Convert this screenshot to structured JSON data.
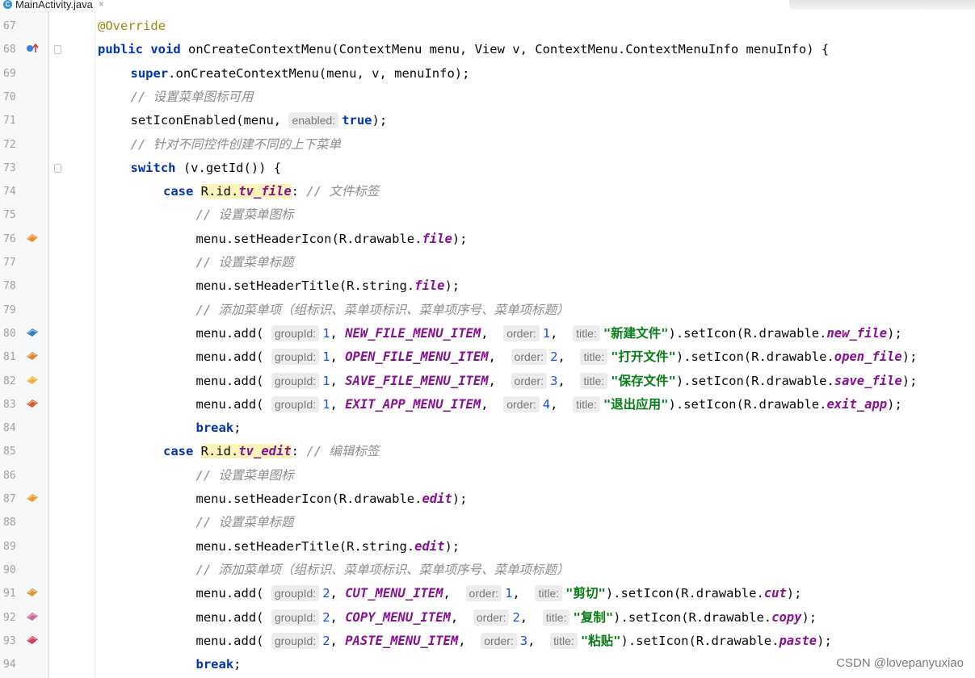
{
  "tab": {
    "icon": "C",
    "name": "MainActivity.java",
    "close": "×"
  },
  "watermark": "CSDN @lovepanyuxiao",
  "colors": {
    "keyword": "#0033b3",
    "string": "#067d17",
    "number": "#1750eb",
    "field": "#871094",
    "comment": "#8c8c8c",
    "annotation": "#9e880d"
  },
  "lines": [
    {
      "num": "67",
      "indent": 0,
      "tokens": [
        {
          "t": "@Override",
          "c": "ann"
        }
      ]
    },
    {
      "num": "68",
      "indent": 0,
      "marker": "override-icon",
      "fold": true,
      "tokens": [
        {
          "t": "public void ",
          "c": "kw"
        },
        {
          "t": "onCreateContextMenu(ContextMenu menu, View v, ContextMenu.ContextMenuInfo menuInfo) {"
        }
      ]
    },
    {
      "num": "69",
      "indent": 1,
      "tokens": [
        {
          "t": "super",
          "c": "kw"
        },
        {
          "t": ".onCreateContextMenu(menu, v, menuInfo);"
        }
      ]
    },
    {
      "num": "70",
      "indent": 1,
      "tokens": [
        {
          "t": "// 设置菜单图标可用",
          "c": "cm"
        }
      ]
    },
    {
      "num": "71",
      "indent": 1,
      "tokens": [
        {
          "t": "setIconEnabled(menu, "
        },
        {
          "t": "enabled:",
          "c": "hint"
        },
        {
          "t": "true",
          "c": "kw"
        },
        {
          "t": ");"
        }
      ]
    },
    {
      "num": "72",
      "indent": 1,
      "tokens": [
        {
          "t": "// 针对不同控件创建不同的上下菜单",
          "c": "cm"
        }
      ]
    },
    {
      "num": "73",
      "indent": 1,
      "fold": true,
      "tokens": [
        {
          "t": "switch ",
          "c": "kw"
        },
        {
          "t": "(v.getId()) {"
        }
      ]
    },
    {
      "num": "74",
      "indent": 2,
      "tokens": [
        {
          "t": "case ",
          "c": "kw"
        },
        {
          "t": "R.id.",
          "c": "hl"
        },
        {
          "t": "tv_file",
          "c": "fld hl"
        },
        {
          "t": ": "
        },
        {
          "t": "// 文件标签",
          "c": "cm"
        }
      ]
    },
    {
      "num": "75",
      "indent": 3,
      "tokens": [
        {
          "t": "// 设置菜单图标",
          "c": "cm"
        }
      ]
    },
    {
      "num": "76",
      "indent": 3,
      "marker": "file-icon",
      "markerColor": "#e8902c",
      "tokens": [
        {
          "t": "menu.setHeaderIcon(R.drawable."
        },
        {
          "t": "file",
          "c": "fld"
        },
        {
          "t": ");"
        }
      ]
    },
    {
      "num": "77",
      "indent": 3,
      "tokens": [
        {
          "t": "// 设置菜单标题",
          "c": "cm"
        }
      ]
    },
    {
      "num": "78",
      "indent": 3,
      "tokens": [
        {
          "t": "menu.setHeaderTitle(R.string."
        },
        {
          "t": "file",
          "c": "fld"
        },
        {
          "t": ");"
        }
      ]
    },
    {
      "num": "79",
      "indent": 3,
      "tokens": [
        {
          "t": "// 添加菜单项（组标识、菜单项标识、菜单项序号、菜单项标题）",
          "c": "cm"
        }
      ]
    },
    {
      "num": "80",
      "indent": 3,
      "marker": "new-file-icon",
      "markerColor": "#3a7fb8",
      "tokens": [
        {
          "t": "menu.add( "
        },
        {
          "t": "groupId:",
          "c": "hint"
        },
        {
          "t": "1",
          "c": "num"
        },
        {
          "t": ", "
        },
        {
          "t": "NEW_FILE_MENU_ITEM",
          "c": "cst"
        },
        {
          "t": ",  "
        },
        {
          "t": "order:",
          "c": "hint"
        },
        {
          "t": "1",
          "c": "num"
        },
        {
          "t": ",  "
        },
        {
          "t": "title:",
          "c": "hint"
        },
        {
          "t": "\"新建文件\"",
          "c": "str"
        },
        {
          "t": ").setIcon(R.drawable."
        },
        {
          "t": "new_file",
          "c": "fld"
        },
        {
          "t": ");"
        }
      ]
    },
    {
      "num": "81",
      "indent": 3,
      "marker": "open-file-icon",
      "markerColor": "#d88a3a",
      "tokens": [
        {
          "t": "menu.add( "
        },
        {
          "t": "groupId:",
          "c": "hint"
        },
        {
          "t": "1",
          "c": "num"
        },
        {
          "t": ", "
        },
        {
          "t": "OPEN_FILE_MENU_ITEM",
          "c": "cst"
        },
        {
          "t": ",  "
        },
        {
          "t": "order:",
          "c": "hint"
        },
        {
          "t": "2",
          "c": "num"
        },
        {
          "t": ",  "
        },
        {
          "t": "title:",
          "c": "hint"
        },
        {
          "t": "\"打开文件\"",
          "c": "str"
        },
        {
          "t": ").setIcon(R.drawable."
        },
        {
          "t": "open_file",
          "c": "fld"
        },
        {
          "t": ");"
        }
      ]
    },
    {
      "num": "82",
      "indent": 3,
      "marker": "save-file-icon",
      "markerColor": "#e8b83a",
      "tokens": [
        {
          "t": "menu.add( "
        },
        {
          "t": "groupId:",
          "c": "hint"
        },
        {
          "t": "1",
          "c": "num"
        },
        {
          "t": ", "
        },
        {
          "t": "SAVE_FILE_MENU_ITEM",
          "c": "cst"
        },
        {
          "t": ",  "
        },
        {
          "t": "order:",
          "c": "hint"
        },
        {
          "t": "3",
          "c": "num"
        },
        {
          "t": ",  "
        },
        {
          "t": "title:",
          "c": "hint"
        },
        {
          "t": "\"保存文件\"",
          "c": "str"
        },
        {
          "t": ").setIcon(R.drawable."
        },
        {
          "t": "save_file",
          "c": "fld"
        },
        {
          "t": ");"
        }
      ]
    },
    {
      "num": "83",
      "indent": 3,
      "marker": "exit-app-icon",
      "markerColor": "#d8602c",
      "tokens": [
        {
          "t": "menu.add( "
        },
        {
          "t": "groupId:",
          "c": "hint"
        },
        {
          "t": "1",
          "c": "num"
        },
        {
          "t": ", "
        },
        {
          "t": "EXIT_APP_MENU_ITEM",
          "c": "cst"
        },
        {
          "t": ",  "
        },
        {
          "t": "order:",
          "c": "hint"
        },
        {
          "t": "4",
          "c": "num"
        },
        {
          "t": ",  "
        },
        {
          "t": "title:",
          "c": "hint"
        },
        {
          "t": "\"退出应用\"",
          "c": "str"
        },
        {
          "t": ").setIcon(R.drawable."
        },
        {
          "t": "exit_app",
          "c": "fld"
        },
        {
          "t": ");"
        }
      ]
    },
    {
      "num": "84",
      "indent": 3,
      "tokens": [
        {
          "t": "break",
          "c": "kw"
        },
        {
          "t": ";"
        }
      ]
    },
    {
      "num": "85",
      "indent": 2,
      "tokens": [
        {
          "t": "case ",
          "c": "kw"
        },
        {
          "t": "R.id.",
          "c": "hl"
        },
        {
          "t": "tv_edit",
          "c": "fld hl"
        },
        {
          "t": ": "
        },
        {
          "t": "// 编辑标签",
          "c": "cm"
        }
      ]
    },
    {
      "num": "86",
      "indent": 3,
      "tokens": [
        {
          "t": "// 设置菜单图标",
          "c": "cm"
        }
      ]
    },
    {
      "num": "87",
      "indent": 3,
      "marker": "edit-icon",
      "markerColor": "#e8a02c",
      "tokens": [
        {
          "t": "menu.setHeaderIcon(R.drawable."
        },
        {
          "t": "edit",
          "c": "fld"
        },
        {
          "t": ");"
        }
      ]
    },
    {
      "num": "88",
      "indent": 3,
      "tokens": [
        {
          "t": "// 设置菜单标题",
          "c": "cm"
        }
      ]
    },
    {
      "num": "89",
      "indent": 3,
      "tokens": [
        {
          "t": "menu.setHeaderTitle(R.string."
        },
        {
          "t": "edit",
          "c": "fld"
        },
        {
          "t": ");"
        }
      ]
    },
    {
      "num": "90",
      "indent": 3,
      "tokens": [
        {
          "t": "// 添加菜单项（组标识、菜单项标识、菜单项序号、菜单项标题）",
          "c": "cm"
        }
      ]
    },
    {
      "num": "91",
      "indent": 3,
      "marker": "cut-icon",
      "markerColor": "#d89a3a",
      "tokens": [
        {
          "t": "menu.add( "
        },
        {
          "t": "groupId:",
          "c": "hint"
        },
        {
          "t": "2",
          "c": "num"
        },
        {
          "t": ", "
        },
        {
          "t": "CUT_MENU_ITEM",
          "c": "cst"
        },
        {
          "t": ",  "
        },
        {
          "t": "order:",
          "c": "hint"
        },
        {
          "t": "1",
          "c": "num"
        },
        {
          "t": ",  "
        },
        {
          "t": "title:",
          "c": "hint"
        },
        {
          "t": "\"剪切\"",
          "c": "str"
        },
        {
          "t": ").setIcon(R.drawable."
        },
        {
          "t": "cut",
          "c": "fld"
        },
        {
          "t": ");"
        }
      ]
    },
    {
      "num": "92",
      "indent": 3,
      "marker": "copy-icon",
      "markerColor": "#c86a9a",
      "tokens": [
        {
          "t": "menu.add( "
        },
        {
          "t": "groupId:",
          "c": "hint"
        },
        {
          "t": "2",
          "c": "num"
        },
        {
          "t": ", "
        },
        {
          "t": "COPY_MENU_ITEM",
          "c": "cst"
        },
        {
          "t": ",  "
        },
        {
          "t": "order:",
          "c": "hint"
        },
        {
          "t": "2",
          "c": "num"
        },
        {
          "t": ",  "
        },
        {
          "t": "title:",
          "c": "hint"
        },
        {
          "t": "\"复制\"",
          "c": "str"
        },
        {
          "t": ").setIcon(R.drawable."
        },
        {
          "t": "copy",
          "c": "fld"
        },
        {
          "t": ");"
        }
      ]
    },
    {
      "num": "93",
      "indent": 3,
      "marker": "paste-icon",
      "markerColor": "#d83a5a",
      "tokens": [
        {
          "t": "menu.add( "
        },
        {
          "t": "groupId:",
          "c": "hint"
        },
        {
          "t": "2",
          "c": "num"
        },
        {
          "t": ", "
        },
        {
          "t": "PASTE_MENU_ITEM",
          "c": "cst"
        },
        {
          "t": ",  "
        },
        {
          "t": "order:",
          "c": "hint"
        },
        {
          "t": "3",
          "c": "num"
        },
        {
          "t": ",  "
        },
        {
          "t": "title:",
          "c": "hint"
        },
        {
          "t": "\"粘贴\"",
          "c": "str"
        },
        {
          "t": ").setIcon(R.drawable."
        },
        {
          "t": "paste",
          "c": "fld"
        },
        {
          "t": ");"
        }
      ]
    },
    {
      "num": "94",
      "indent": 3,
      "tokens": [
        {
          "t": "break",
          "c": "kw"
        },
        {
          "t": ";"
        }
      ]
    }
  ]
}
